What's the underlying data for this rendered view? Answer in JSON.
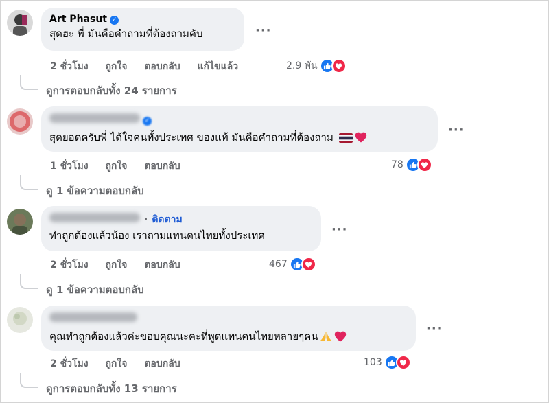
{
  "comments": [
    {
      "name": "Art Phasut",
      "verified": true,
      "text": "สุดฮะ พี่ มันคือคำถามที่ต้องถามคับ",
      "actions": {
        "time": "2 ชั่วโมง",
        "like": "ถูกใจ",
        "reply": "ตอบกลับ",
        "edited": "แก้ไขแล้ว"
      },
      "reaction_count": "2.9 พัน",
      "replies_link": "ดูการตอบกลับทั้ง 24 รายการ"
    },
    {
      "name": "",
      "verified": true,
      "text": "สุดยอดครับพี่ ได้ใจคนทั้งประเทศ ของแท้ มันคือคำถามที่ต้องถาม",
      "actions": {
        "time": "1 ชั่วโมง",
        "like": "ถูกใจ",
        "reply": "ตอบกลับ"
      },
      "reaction_count": "78",
      "replies_link": "ดู 1 ข้อความตอบกลับ"
    },
    {
      "name": "",
      "follow": "ติดตาม",
      "text": "ทำถูกต้องแล้วน้อง เราถามแทนคนไทยทั้งประเทศ",
      "actions": {
        "time": "2 ชั่วโมง",
        "like": "ถูกใจ",
        "reply": "ตอบกลับ"
      },
      "reaction_count": "467",
      "replies_link": "ดู 1 ข้อความตอบกลับ"
    },
    {
      "name": "",
      "text": "คุณทำถูกต้องแล้วค่ะขอบคุณนะคะที่พูดแทนคนไทยหลายๆคน",
      "actions": {
        "time": "2 ชั่วโมง",
        "like": "ถูกใจ",
        "reply": "ตอบกลับ"
      },
      "reaction_count": "103",
      "replies_link": "ดูการตอบกลับทั้ง 13 รายการ"
    }
  ],
  "more_label": "···",
  "colors": {
    "like": "#1877f2",
    "love": "#f02849",
    "bubble": "#eef0f3",
    "meta": "#65676b"
  },
  "icons": [
    "verified-badge-icon",
    "like-reaction-icon",
    "love-reaction-icon",
    "thai-flag-icon",
    "heart-icon",
    "praying-hands-icon",
    "more-options-icon"
  ]
}
